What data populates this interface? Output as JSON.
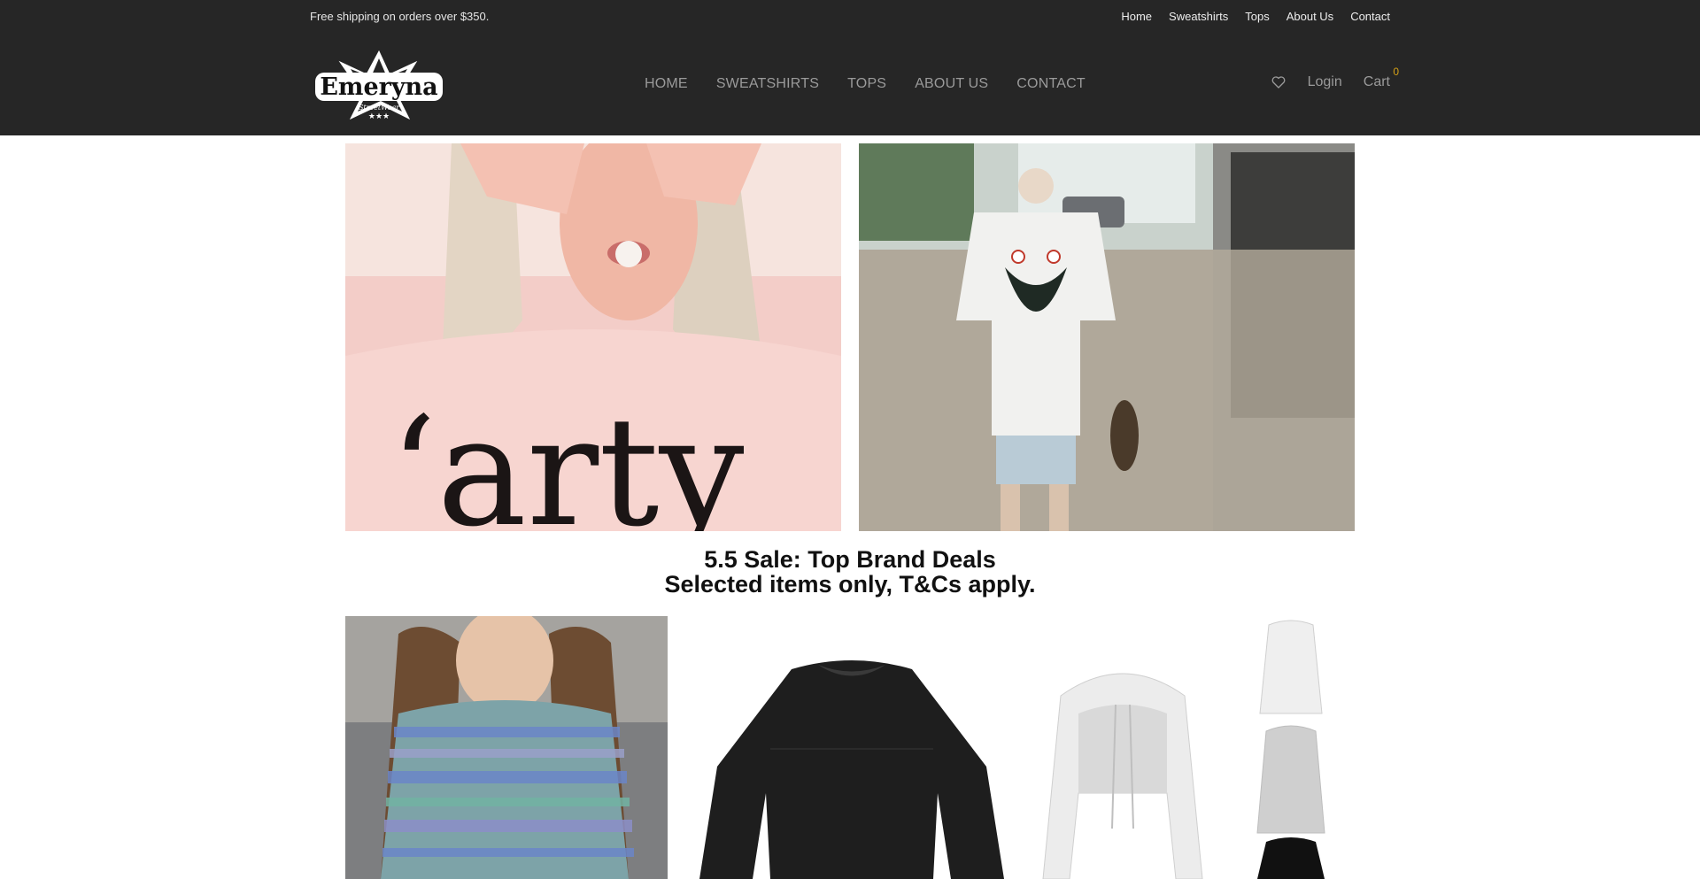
{
  "topbar": {
    "shipping_text": "Free shipping on orders over $350.",
    "links": [
      "Home",
      "Sweatshirts",
      "Tops",
      "About Us",
      "Contact"
    ]
  },
  "logo": {
    "text": "Emeryna",
    "tagline": "StreetWear"
  },
  "mainnav": [
    "HOME",
    "SWEATSHIRTS",
    "TOPS",
    "ABOUT US",
    "CONTACT"
  ],
  "account": {
    "login_label": "Login",
    "cart_label": "Cart",
    "cart_count": "0",
    "wishlist_icon": "heart-icon"
  },
  "banners": [
    {
      "name": "hero-banner-party-tee"
    },
    {
      "name": "hero-banner-shark-tee"
    }
  ],
  "sale": {
    "line1": "5.5 Sale: Top Brand Deals",
    "line2": "Selected items only, T&Cs apply."
  },
  "products": [
    {
      "name": "product-fair-isle-sweater"
    },
    {
      "name": "product-black-sweatshirt"
    },
    {
      "name": "product-cropped-hoodie"
    }
  ],
  "colors": {
    "header_bg": "#262626",
    "nav_text": "#9a9a9a",
    "cart_badge": "#d4a017",
    "sale_text": "#111111"
  }
}
